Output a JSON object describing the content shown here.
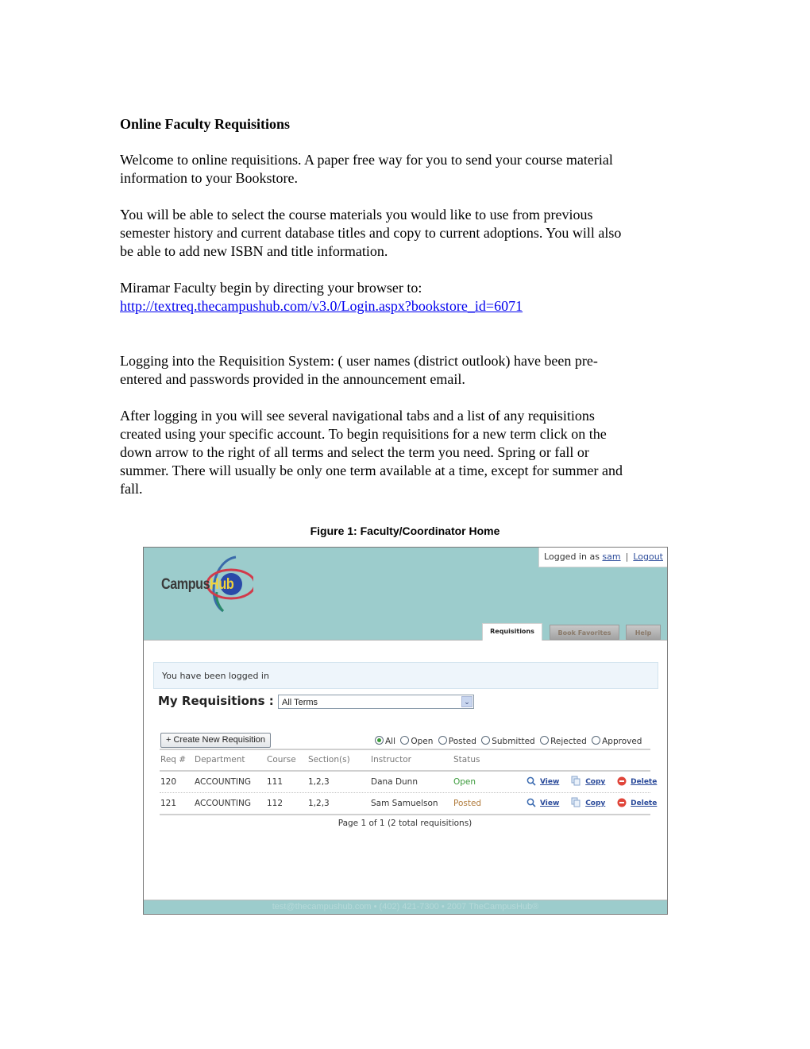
{
  "document": {
    "title": "Online Faculty Requisitions",
    "paragraphs": {
      "welcome_line1": "Welcome to online requisitions.  A paper free way for you to send your course material",
      "welcome_line2": "information to your Bookstore.",
      "select_line1": "You will be able to select the course materials you would like to use from previous",
      "select_line2": "semester history and current database titles and copy to current adoptions. You will also",
      "select_line3": "be able to add new ISBN and title information.",
      "miramar_line1": "Miramar Faculty begin by directing your browser to:",
      "miramar_link": "http://textreq.thecampushub.com/v3.0/Login.aspx?bookstore_id=6071",
      "login_line1": "Logging into the Requisition System: ( user names (district outlook) have been pre-",
      "login_line2": "entered and passwords provided in the announcement email.",
      "after_line1": "After logging in you will see several navigational tabs and a list of any requisitions",
      "after_line2": "created using your specific account.  To begin requisitions for a new term click on the",
      "after_line3": "down arrow to the right of all terms and select the term you need. Spring or fall or",
      "after_line4": "summer.  There will usually be only one term available at a time, except for summer and",
      "after_line5": "fall."
    },
    "figure_caption": "Figure 1:  Faculty/Coordinator Home"
  },
  "screenshot": {
    "logo": {
      "campus": "Campus",
      "hub": "Hub"
    },
    "login": {
      "prefix": "Logged in as",
      "user": "sam",
      "separator": "|",
      "logout": "Logout"
    },
    "tabs": [
      {
        "label": "Requisitions",
        "active": true
      },
      {
        "label": "Book Favorites",
        "active": false
      },
      {
        "label": "Help",
        "active": false
      }
    ],
    "message": "You have been logged in",
    "my_requisitions_label": "My Requisitions :",
    "term_select": {
      "value": "All Terms"
    },
    "create_button": "+ Create New Requisition",
    "filters": {
      "selected": "All",
      "options": [
        "All",
        "Open",
        "Posted",
        "Submitted",
        "Rejected",
        "Approved"
      ]
    },
    "table": {
      "headers": [
        "Req #",
        "Department",
        "Course",
        "Section(s)",
        "Instructor",
        "Status"
      ],
      "rows": [
        {
          "req": "120",
          "department": "ACCOUNTING",
          "course": "111",
          "sections": "1,2,3",
          "instructor": "Dana Dunn",
          "status": "Open"
        },
        {
          "req": "121",
          "department": "ACCOUNTING",
          "course": "112",
          "sections": "1,2,3",
          "instructor": "Sam Samuelson",
          "status": "Posted"
        }
      ],
      "actions": {
        "view": "View",
        "copy": "Copy",
        "delete": "Delete"
      },
      "pager": "Page 1 of 1 (2 total requisitions)"
    },
    "footer": "test@thecampushub.com •  (402) 421-7300 •  2007 TheCampusHub®",
    "colors": {
      "header_bg": "#9ccccc",
      "status_open": "#3a9a3a",
      "status_posted": "#b07a3a",
      "link": "#2a4a9a"
    }
  }
}
